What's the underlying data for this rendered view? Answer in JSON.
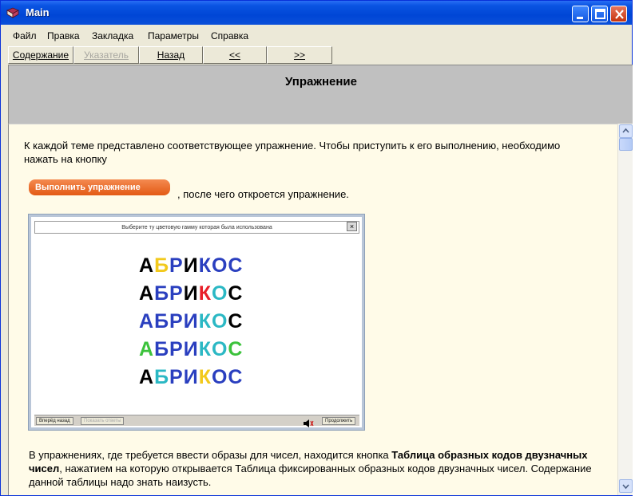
{
  "window": {
    "title": "Main"
  },
  "menu": [
    "Файл",
    "Правка",
    "Закладка",
    "Параметры",
    "Справка"
  ],
  "toolbar": {
    "contents": "Содержание",
    "index": "Указатель",
    "back": "Назад",
    "prev": "<<",
    "next": ">>"
  },
  "header": {
    "title": "Упражнение"
  },
  "body": {
    "intro": "К каждой теме представлено соответствующее упражнение. Чтобы приступить к его выполнению, необходимо нажать на кнопку",
    "run_button": "Выполнить упражнение",
    "after_button": ", после чего откроется упражнение.",
    "para_start": "В упражнениях, где требуется ввести образы для чисел, находится кнопка",
    "para_bold": "Таблица образных кодов двузначных чисел",
    "para_end": ", нажатием на которую открывается Таблица фиксированных образных кодов двузначных чисел. Содержание данной таблицы надо знать наизусть."
  },
  "exercise": {
    "title": "Выберите ту цветовую гамму которая была использована",
    "close": "×",
    "words": [
      [
        {
          "ch": "А",
          "color": "#000000"
        },
        {
          "ch": "Б",
          "color": "#f2c91c"
        },
        {
          "ch": "Р",
          "color": "#2a3fbf"
        },
        {
          "ch": "И",
          "color": "#000000"
        },
        {
          "ch": "К",
          "color": "#2a3fbf"
        },
        {
          "ch": "О",
          "color": "#2a3fbf"
        },
        {
          "ch": "С",
          "color": "#2a3fbf"
        }
      ],
      [
        {
          "ch": "А",
          "color": "#000000"
        },
        {
          "ch": "Б",
          "color": "#2a3fbf"
        },
        {
          "ch": "Р",
          "color": "#2a3fbf"
        },
        {
          "ch": "И",
          "color": "#000000"
        },
        {
          "ch": "К",
          "color": "#e8202a"
        },
        {
          "ch": "О",
          "color": "#2bb8c4"
        },
        {
          "ch": "С",
          "color": "#000000"
        }
      ],
      [
        {
          "ch": "А",
          "color": "#2a3fbf"
        },
        {
          "ch": "Б",
          "color": "#2a3fbf"
        },
        {
          "ch": "Р",
          "color": "#2a3fbf"
        },
        {
          "ch": "И",
          "color": "#2a3fbf"
        },
        {
          "ch": "К",
          "color": "#2bb8c4"
        },
        {
          "ch": "О",
          "color": "#2bb8c4"
        },
        {
          "ch": "С",
          "color": "#000000"
        }
      ],
      [
        {
          "ch": "А",
          "color": "#3cc23c"
        },
        {
          "ch": "Б",
          "color": "#2a3fbf"
        },
        {
          "ch": "Р",
          "color": "#2a3fbf"
        },
        {
          "ch": "И",
          "color": "#2a3fbf"
        },
        {
          "ch": "К",
          "color": "#2bb8c4"
        },
        {
          "ch": "О",
          "color": "#2bb8c4"
        },
        {
          "ch": "С",
          "color": "#3cc23c"
        }
      ],
      [
        {
          "ch": "А",
          "color": "#000000"
        },
        {
          "ch": "Б",
          "color": "#2bb8c4"
        },
        {
          "ch": "Р",
          "color": "#2a3fbf"
        },
        {
          "ch": "И",
          "color": "#2a3fbf"
        },
        {
          "ch": "К",
          "color": "#f2c91c"
        },
        {
          "ch": "О",
          "color": "#2a3fbf"
        },
        {
          "ch": "С",
          "color": "#2a3fbf"
        }
      ]
    ],
    "bottom_left": "Вперёд назад",
    "bottom_left2": "Показать ответы",
    "bottom_right": "Продолжить"
  },
  "colors": {
    "title_bar": "#0a54e2",
    "content_bg": "#fffbe8",
    "header_bg": "#c0c0c0",
    "accent": "#e35a14"
  },
  "icons": [
    "book-icon",
    "minimize-icon",
    "maximize-icon",
    "close-icon",
    "scroll-up-icon",
    "scroll-down-icon",
    "speaker-icon"
  ]
}
